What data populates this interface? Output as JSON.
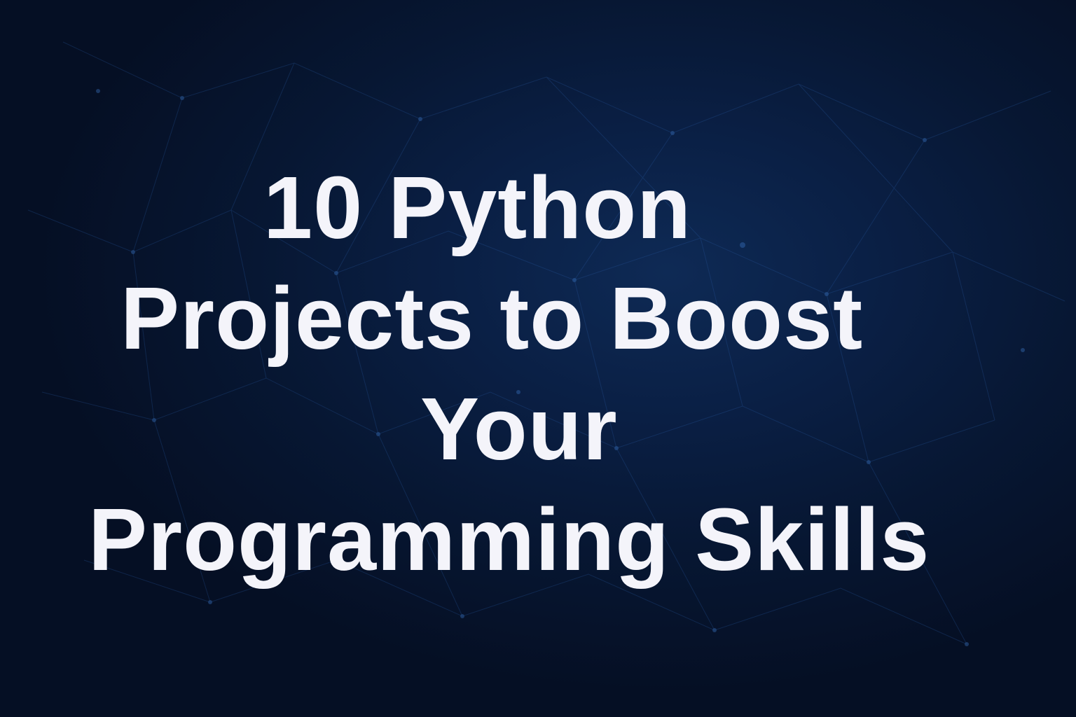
{
  "title": {
    "line1": "10 Python",
    "line2": "Projects to Boost",
    "line3": "Your",
    "line4": "Programming Skills"
  },
  "colors": {
    "background": "#0a1f44",
    "text": "#f4f4fa",
    "network": "#2b5ea8"
  }
}
